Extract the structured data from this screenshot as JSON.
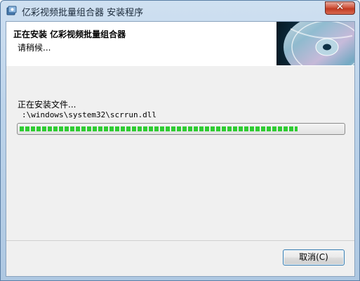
{
  "window": {
    "title": "亿彩视频批量组合器 安装程序",
    "close_label": "✕"
  },
  "header": {
    "title": "正在安装 亿彩视频批量组合器",
    "subtitle": "请稍候..."
  },
  "body": {
    "status_text": "正在安装文件...",
    "detail_text": ":\\windows\\system32\\scrrun.dll",
    "progress_fraction": 0.86
  },
  "footer": {
    "cancel_label": "取消(C)"
  }
}
